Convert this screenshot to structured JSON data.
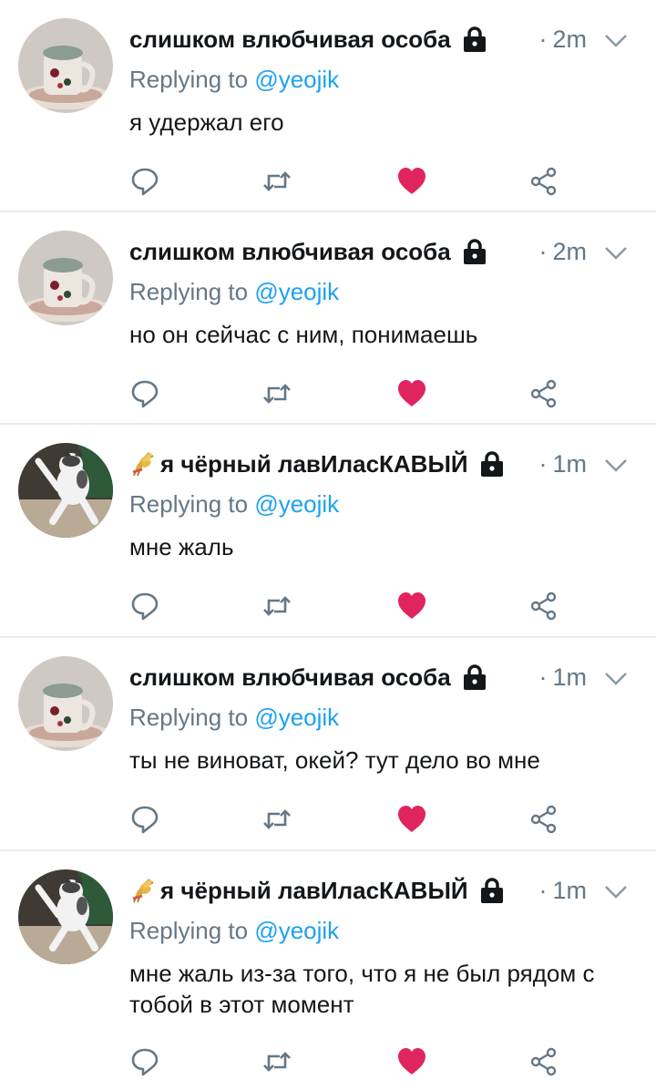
{
  "tweets": [
    {
      "display_name": "слишком влюбчивая особа",
      "avatar": "cup-avatar",
      "has_emoji": false,
      "time": "2m",
      "reply_prefix": "Replying to ",
      "reply_handle": "@yeojik",
      "text": "я удержал его"
    },
    {
      "display_name": "слишком влюбчивая особа",
      "avatar": "cup-avatar",
      "has_emoji": false,
      "time": "2m",
      "reply_prefix": "Replying to ",
      "reply_handle": "@yeojik",
      "text": "но он сейчас с ним, понимаешь"
    },
    {
      "display_name": "я чёрный лавИласКАВЫЙ",
      "avatar": "cat-avatar",
      "has_emoji": true,
      "time": "1m",
      "reply_prefix": "Replying to ",
      "reply_handle": "@yeojik",
      "text": "мне жаль"
    },
    {
      "display_name": "слишком влюбчивая особа",
      "avatar": "cup-avatar",
      "has_emoji": false,
      "time": "1m",
      "reply_prefix": "Replying to ",
      "reply_handle": "@yeojik",
      "text": "ты не виноват, окей? тут дело во мне"
    },
    {
      "display_name": "я чёрный лавИласКАВЫЙ",
      "avatar": "cat-avatar",
      "has_emoji": true,
      "time": "1m",
      "reply_prefix": "Replying to ",
      "reply_handle": "@yeojik",
      "text": "мне жаль из-за того, что я не был рядом с тобой в этот момент"
    }
  ],
  "icons": {
    "reply": "reply-icon",
    "retweet": "retweet-icon",
    "like": "heart-icon",
    "share": "share-icon",
    "lock": "lock-icon",
    "menu": "chevron-down-icon",
    "name_emoji": "sheaf-of-rice-icon"
  },
  "colors": {
    "name": "#14171a",
    "secondary": "#657786",
    "link": "#1da1f2",
    "like": "#e0245e",
    "divider": "#e6ecf0"
  }
}
